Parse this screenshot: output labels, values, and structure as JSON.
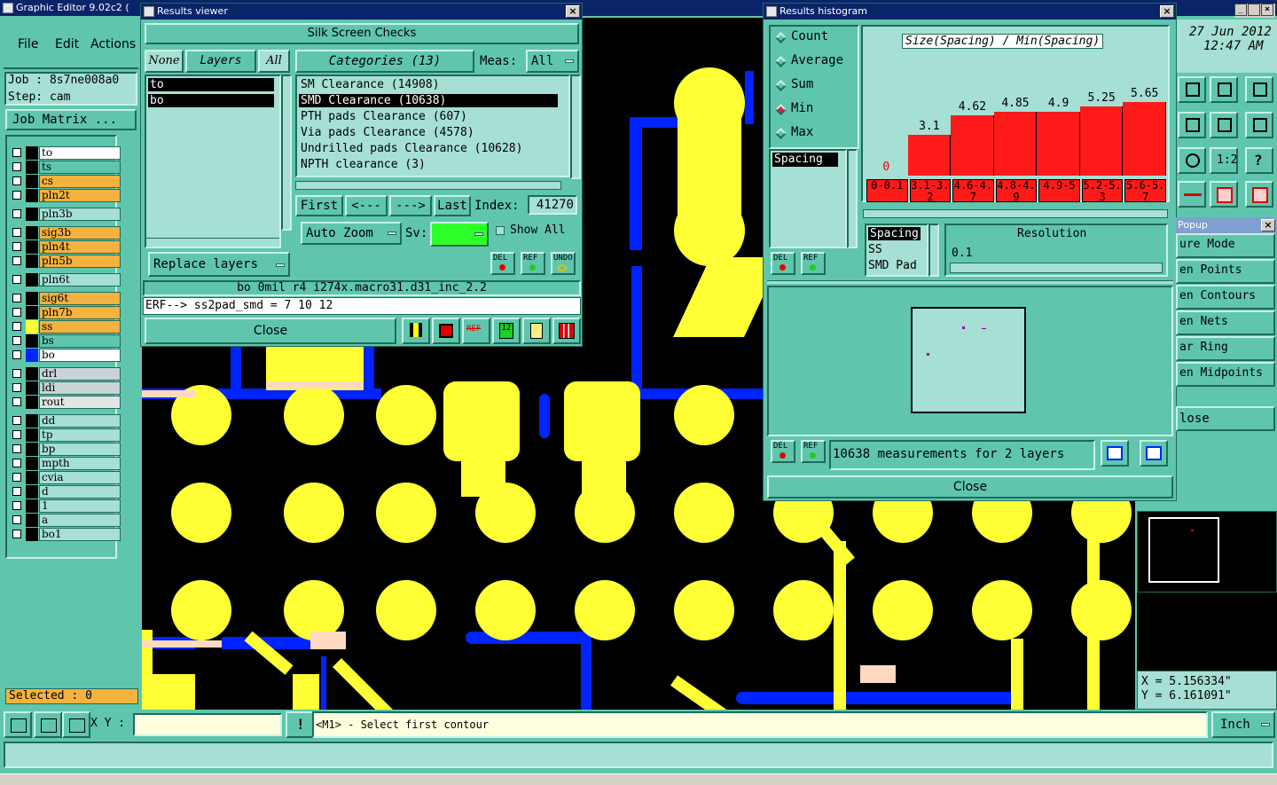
{
  "app": {
    "title": "Graphic Editor 9.02c2 ("
  },
  "menu": {
    "file": "File",
    "edit": "Edit",
    "actions": "Actions"
  },
  "job": {
    "job": "Job : 8s7ne008a0",
    "step": "Step: cam",
    "matrix": "Job Matrix ..."
  },
  "layers": [
    {
      "name": "to",
      "color": "#ffffff"
    },
    {
      "name": "ts",
      "color": "#5fc6ad"
    },
    {
      "name": "cs",
      "color": "#f4b23e"
    },
    {
      "name": "pln2t",
      "color": "#f4b23e"
    },
    {
      "name": "pln3b",
      "color": "#a6dfd4"
    },
    {
      "name": "sig3b",
      "color": "#f4b23e"
    },
    {
      "name": "pln4t",
      "color": "#f4b23e"
    },
    {
      "name": "pln5b",
      "color": "#f4b23e"
    },
    {
      "name": "pln6t",
      "color": "#a6dfd4"
    },
    {
      "name": "sig6t",
      "color": "#f4b23e"
    },
    {
      "name": "pln7b",
      "color": "#f4b23e"
    },
    {
      "name": "ss",
      "color": "#f4b23e"
    },
    {
      "name": "bs",
      "color": "#5fc6ad"
    },
    {
      "name": "bo",
      "color": "#ffffff"
    },
    {
      "name": "drl",
      "color": "#c8d4d8"
    },
    {
      "name": "ldi",
      "color": "#c8d4d8"
    },
    {
      "name": "rout",
      "color": "#e4e4e4"
    },
    {
      "name": "dd",
      "color": "#a6dfd4"
    },
    {
      "name": "tp",
      "color": "#a6dfd4"
    },
    {
      "name": "bp",
      "color": "#a6dfd4"
    },
    {
      "name": "mpth",
      "color": "#a6dfd4"
    },
    {
      "name": "cvia",
      "color": "#a6dfd4"
    },
    {
      "name": "d",
      "color": "#a6dfd4"
    },
    {
      "name": "1",
      "color": "#a6dfd4"
    },
    {
      "name": "a",
      "color": "#a6dfd4"
    },
    {
      "name": "bo1",
      "color": "#a6dfd4"
    }
  ],
  "selected": "Selected : 0",
  "results_viewer": {
    "title": "Results viewer",
    "header": "Silk Screen Checks",
    "none": "None",
    "layers": "Layers",
    "all": "All",
    "layer_list": [
      "to",
      "bo"
    ],
    "categories_btn": "Categories (13)",
    "meas_label": "Meas:",
    "meas_value": "All",
    "categories": [
      "SM Clearance (14908)",
      "SMD Clearance (10638)",
      "PTH pads Clearance (607)",
      "Via pads Clearance (4578)",
      "Undrilled pads Clearance (10628)",
      "NPTH clearance (3)"
    ],
    "first": "First",
    "prev": "<---",
    "next": "--->",
    "last": "Last",
    "index_label": "Index:",
    "index_value": "41270",
    "auto_zoom": "Auto Zoom",
    "sv_label": "Sv:",
    "show_all": "Show All",
    "replace_layers": "Replace layers",
    "del": "DEL",
    "ref": "REF",
    "undo": "UNDO",
    "status": "bo 0mil  r4  i274x.macro31.d31_inc_2.2",
    "erf": "ERF--> ss2pad_smd = 7 10 12",
    "close": "Close"
  },
  "histogram": {
    "title": "Results histogram",
    "options": [
      "Count",
      "Average",
      "Sum",
      "Min",
      "Max"
    ],
    "selected_option": "Min",
    "chart_title": "Size(Spacing) / Min(Spacing)",
    "list_item": "Spacing",
    "sublist": [
      "Spacing",
      "SS",
      "SMD Pad"
    ],
    "resolution_label": "Resolution",
    "resolution_value": "0.1",
    "measurements": "10638 measurements for 2 layers",
    "close": "Close",
    "del": "DEL",
    "ref": "REF"
  },
  "chart_data": {
    "type": "bar",
    "title": "Size(Spacing) / Min(Spacing)",
    "categories": [
      "0-0.1",
      "3.1-3.2",
      "4.6-4.7",
      "4.8-4.9",
      "4.9-5",
      "5.2-5.3",
      "5.6-5.7"
    ],
    "value_labels": [
      "0",
      "3.1",
      "4.62",
      "4.85",
      "4.9",
      "5.25",
      "5.65"
    ],
    "values": [
      0,
      3.1,
      4.62,
      4.85,
      4.9,
      5.25,
      5.65
    ],
    "bar_color": "#ff1a1a"
  },
  "clock": {
    "date": "27 Jun 2012",
    "time": "12:47 AM"
  },
  "popup": {
    "title": "Popup",
    "items": [
      "ure Mode",
      "en Points",
      "en Contours",
      "en Nets",
      "ar Ring",
      "en Midpoints"
    ],
    "close": "lose"
  },
  "coords": {
    "x": "X = 5.156334\"",
    "y": "Y = 6.161091\""
  },
  "bottom": {
    "xy_label": "X Y :",
    "xy_value": "",
    "prompt": "<M1> - Select first contour",
    "units": "Inch"
  }
}
